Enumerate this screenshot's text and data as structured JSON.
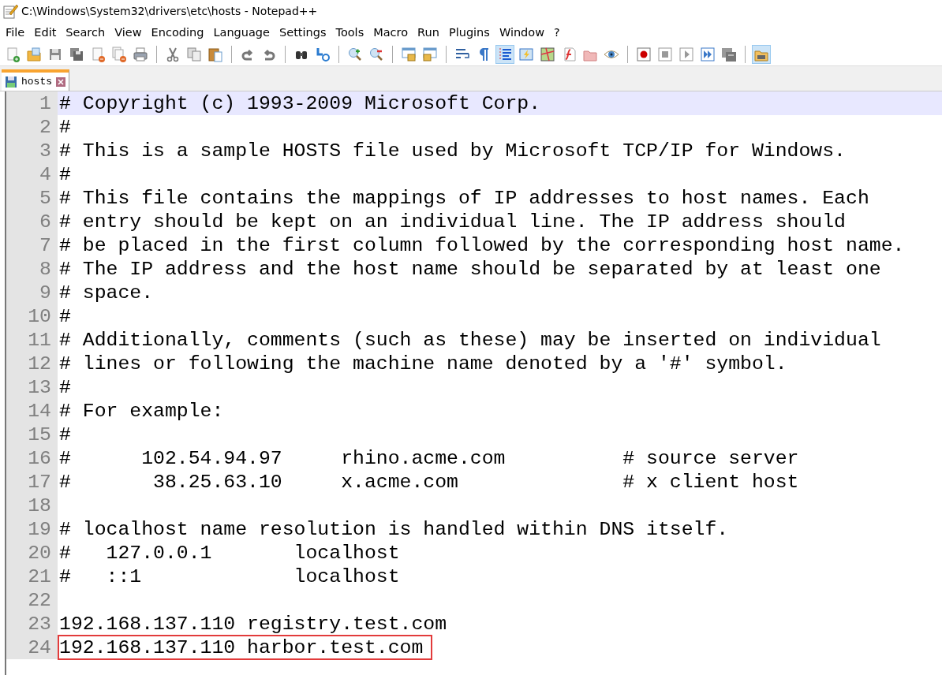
{
  "window": {
    "title": "C:\\Windows\\System32\\drivers\\etc\\hosts - Notepad++"
  },
  "menu": [
    "File",
    "Edit",
    "Search",
    "View",
    "Encoding",
    "Language",
    "Settings",
    "Tools",
    "Macro",
    "Run",
    "Plugins",
    "Window",
    "?"
  ],
  "toolbar": [
    {
      "kind": "button",
      "pressed": false
    },
    {
      "kind": "button",
      "pressed": false
    },
    {
      "kind": "button",
      "pressed": false
    },
    {
      "kind": "button",
      "pressed": false
    },
    {
      "kind": "button",
      "pressed": false
    },
    {
      "kind": "button",
      "pressed": false
    },
    {
      "kind": "button",
      "pressed": false
    },
    {
      "kind": "separator"
    },
    {
      "kind": "button",
      "pressed": false
    },
    {
      "kind": "button",
      "pressed": false
    },
    {
      "kind": "button",
      "pressed": false
    },
    {
      "kind": "separator"
    },
    {
      "kind": "button",
      "pressed": false
    },
    {
      "kind": "button",
      "pressed": false
    },
    {
      "kind": "separator"
    },
    {
      "kind": "button",
      "pressed": false
    },
    {
      "kind": "button",
      "pressed": false
    },
    {
      "kind": "separator"
    },
    {
      "kind": "button",
      "pressed": false
    },
    {
      "kind": "button",
      "pressed": false
    },
    {
      "kind": "separator"
    },
    {
      "kind": "button",
      "pressed": false
    },
    {
      "kind": "button",
      "pressed": false
    },
    {
      "kind": "separator"
    },
    {
      "kind": "button",
      "pressed": false
    },
    {
      "kind": "button",
      "pressed": false
    },
    {
      "kind": "button",
      "pressed": true
    },
    {
      "kind": "button",
      "pressed": false
    },
    {
      "kind": "button",
      "pressed": false
    },
    {
      "kind": "button",
      "pressed": false
    },
    {
      "kind": "button",
      "pressed": false
    },
    {
      "kind": "button",
      "pressed": false
    },
    {
      "kind": "separator"
    },
    {
      "kind": "button",
      "pressed": false
    },
    {
      "kind": "button",
      "pressed": false
    },
    {
      "kind": "button",
      "pressed": false
    },
    {
      "kind": "button",
      "pressed": false
    },
    {
      "kind": "button",
      "pressed": false
    },
    {
      "kind": "separator"
    },
    {
      "kind": "button",
      "pressed": true
    }
  ],
  "tabs": [
    {
      "label": "hosts",
      "selected": true
    }
  ],
  "editor": {
    "lines": [
      {
        "number": "1",
        "text": "# Copyright (c) 1993-2009 Microsoft Corp.",
        "current": true
      },
      {
        "number": "2",
        "text": "#"
      },
      {
        "number": "3",
        "text": "# This is a sample HOSTS file used by Microsoft TCP/IP for Windows."
      },
      {
        "number": "4",
        "text": "#"
      },
      {
        "number": "5",
        "text": "# This file contains the mappings of IP addresses to host names. Each"
      },
      {
        "number": "6",
        "text": "# entry should be kept on an individual line. The IP address should"
      },
      {
        "number": "7",
        "text": "# be placed in the first column followed by the corresponding host name."
      },
      {
        "number": "8",
        "text": "# The IP address and the host name should be separated by at least one"
      },
      {
        "number": "9",
        "text": "# space."
      },
      {
        "number": "10",
        "text": "#"
      },
      {
        "number": "11",
        "text": "# Additionally, comments (such as these) may be inserted on individual"
      },
      {
        "number": "12",
        "text": "# lines or following the machine name denoted by a '#' symbol."
      },
      {
        "number": "13",
        "text": "#"
      },
      {
        "number": "14",
        "text": "# For example:"
      },
      {
        "number": "15",
        "text": "#"
      },
      {
        "number": "16",
        "text": "#      102.54.94.97     rhino.acme.com          # source server"
      },
      {
        "number": "17",
        "text": "#       38.25.63.10     x.acme.com              # x client host"
      },
      {
        "number": "18"
      },
      {
        "number": "19",
        "text": "# localhost name resolution is handled within DNS itself."
      },
      {
        "number": "20",
        "text": "#   127.0.0.1       localhost"
      },
      {
        "number": "21",
        "text": "#   ::1             localhost"
      },
      {
        "number": "22"
      },
      {
        "number": "23",
        "text": "192.168.137.110 registry.test.com"
      },
      {
        "number": "24",
        "text": "192.168.137.110 harbor.test.com",
        "outlined": true
      }
    ]
  }
}
